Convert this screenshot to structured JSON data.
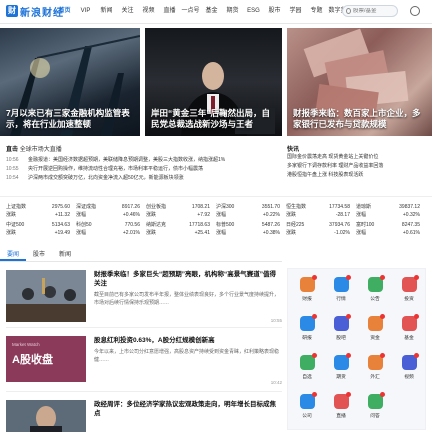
{
  "brand": {
    "logo_mark": "财",
    "logo_text": "新浪财经"
  },
  "nav": [
    "首页",
    "VIP",
    "新闻",
    "关注",
    "视频",
    "直播",
    "一点号",
    "基金",
    "期货",
    "ESG",
    "股市",
    "学园",
    "专题",
    "数字货"
  ],
  "search": {
    "placeholder": "股票/基金"
  },
  "banners": [
    {
      "caption": "7月以来已有三家金融机构监管表示，将在行业加速整顿"
    },
    {
      "caption": "岸田“黄金三年”后鞠然出局，自民党总裁选战新沙场与王者"
    },
    {
      "caption": "财报季来临：数百家上市企业，多家银行已发布与贷款规模"
    }
  ],
  "news": {
    "heading": "直击",
    "heading_sub": "全球市场大直播",
    "rows": [
      {
        "time": "10:56",
        "text": "金融报道：美国经济数据超预期，美联储降息预期调整，美股三大指数收涨，纳指涨超1%"
      },
      {
        "time": "10:55",
        "text": "央行开展逆回购操作，维持流动性合理充裕，市场利率平稳运行，债市小幅震荡"
      },
      {
        "time": "10:54",
        "text": "沪深两市成交额突破万亿，北向资金净流入超50亿元，新能源板块领涨"
      }
    ],
    "flash_heading": "快讯",
    "flash_rows": [
      "国际金价震荡走高 现货黄金站上关键价位",
      "多家银行下调存款利率 理财产品收益率回落",
      "港股恒指午盘上涨 科技股表现活跃"
    ]
  },
  "market": {
    "rows": [
      [
        {
          "n": "上证指数",
          "v": "2975.60",
          "c": "up"
        },
        {
          "n": "深证成指",
          "v": "8917.26",
          "c": "up"
        },
        {
          "n": "创业板指",
          "v": "1708.21",
          "c": "up"
        },
        {
          "n": "沪深300",
          "v": "3551.70",
          "c": "up"
        },
        {
          "n": "恒生指数",
          "v": "17734.58",
          "c": "down"
        },
        {
          "n": "道琼斯",
          "v": "39837.12",
          "c": "up"
        }
      ],
      [
        {
          "n": "涨跌",
          "v": "+11.32",
          "c": "up"
        },
        {
          "n": "涨幅",
          "v": "+0.46%",
          "c": "up"
        },
        {
          "n": "涨跌",
          "v": "+7.92",
          "c": "up"
        },
        {
          "n": "涨幅",
          "v": "+0.22%",
          "c": "up"
        },
        {
          "n": "涨跌",
          "v": "-28.17",
          "c": "down"
        },
        {
          "n": "涨幅",
          "v": "+0.32%",
          "c": "up"
        }
      ],
      [
        {
          "n": "中证500",
          "v": "5134.63",
          "c": "up"
        },
        {
          "n": "科创50",
          "v": "770.56",
          "c": "up"
        },
        {
          "n": "纳斯达克",
          "v": "17718.63",
          "c": "up"
        },
        {
          "n": "标普500",
          "v": "5487.26",
          "c": "up"
        },
        {
          "n": "日经225",
          "v": "37934.76",
          "c": "down"
        },
        {
          "n": "富时100",
          "v": "8247.35",
          "c": "up"
        }
      ],
      [
        {
          "n": "涨跌",
          "v": "+19.49",
          "c": "up"
        },
        {
          "n": "涨幅",
          "v": "+2.01%",
          "c": "up"
        },
        {
          "n": "涨跌",
          "v": "+25.41",
          "c": "up"
        },
        {
          "n": "涨幅",
          "v": "+0.38%",
          "c": "up"
        },
        {
          "n": "涨跌",
          "v": "-1.02%",
          "c": "down"
        },
        {
          "n": "涨幅",
          "v": "+0.61%",
          "c": "up"
        }
      ]
    ]
  },
  "tabs": [
    "要闻",
    "股市",
    "新闻"
  ],
  "articles": [
    {
      "title": "财报季来临！多家巨头“超预期”亮眼，机构称“高景气赛道”值得关注",
      "summary": "截至目前已有多家公司发布半年报，整体业绩表现良好，多个行业景气度持续提升，市场对后续行情保持乐观预期……",
      "meta": "10:55"
    },
    {
      "title": "股息红利投资0.63%，A股分红规模创新高",
      "summary": "今年以来，上市公司分红意愿增强，高股息资产持续受到资金青睐，红利策略表现稳健……",
      "meta": "10:42",
      "thumb_title": "A股收盘",
      "thumb_top": "Market Watch"
    },
    {
      "title": "政经周评：多位经济学家热议宏观政策走向，明年增长目标成焦点",
      "summary": "",
      "meta": ""
    }
  ],
  "side_items": [
    {
      "label": "财报",
      "color": "#e8823a"
    },
    {
      "label": "行情",
      "color": "#2b8ae6"
    },
    {
      "label": "公告",
      "color": "#3fae62"
    },
    {
      "label": "投资",
      "color": "#e25454"
    },
    {
      "label": "研报",
      "color": "#2b8ae6"
    },
    {
      "label": "股吧",
      "color": "#4a5fd6"
    },
    {
      "label": "资金",
      "color": "#e8823a"
    },
    {
      "label": "基金",
      "color": "#e25454"
    },
    {
      "label": "自选",
      "color": "#3fae62"
    },
    {
      "label": "期货",
      "color": "#2b8ae6"
    },
    {
      "label": "外汇",
      "color": "#e8823a"
    },
    {
      "label": "视频",
      "color": "#4a5fd6"
    },
    {
      "label": "公司",
      "color": "#2b8ae6"
    },
    {
      "label": "直播",
      "color": "#e25454"
    },
    {
      "label": "问答",
      "color": "#3fae62"
    }
  ]
}
